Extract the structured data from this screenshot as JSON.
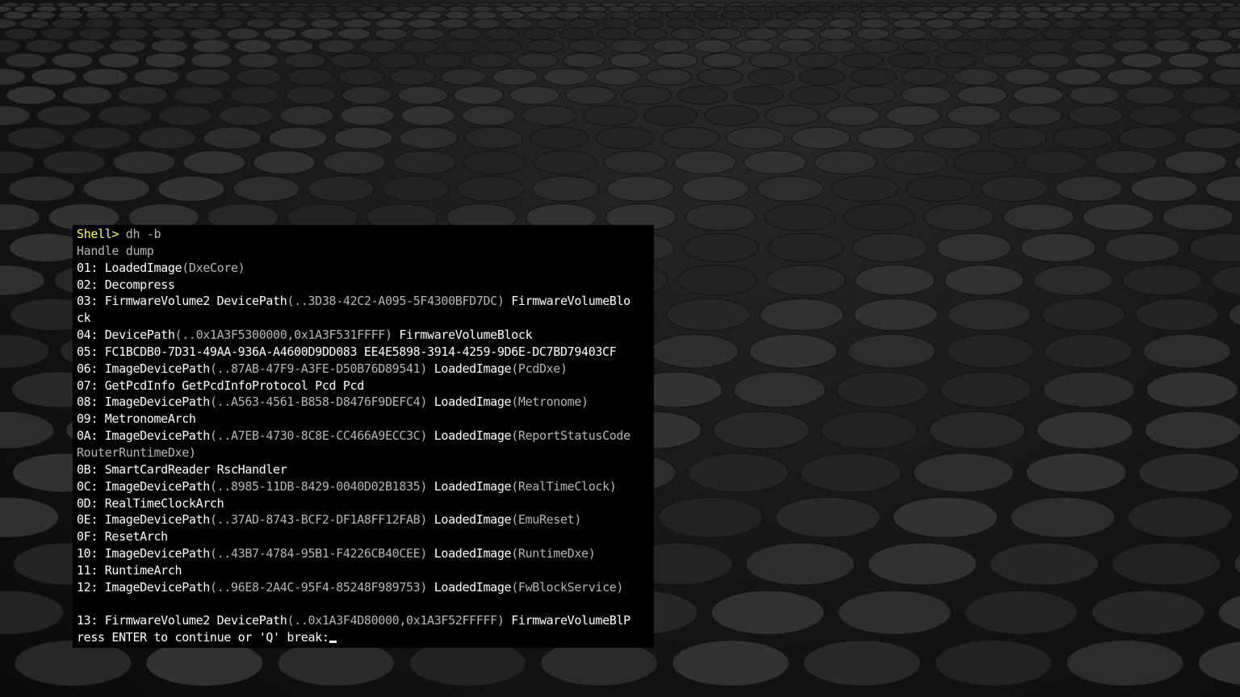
{
  "terminal": {
    "prompt": "Shell>",
    "command": " dh -b",
    "lines": [
      [
        {
          "t": "Handle dump",
          "c": "g"
        }
      ],
      [
        {
          "t": "01: LoadedImage",
          "c": "w"
        },
        {
          "t": "(DxeCore)",
          "c": "g"
        }
      ],
      [
        {
          "t": "02: Decompress",
          "c": "w"
        }
      ],
      [
        {
          "t": "03: FirmwareVolume2 DevicePath",
          "c": "w"
        },
        {
          "t": "(..3D38-42C2-A095-5F4300BFD7DC)",
          "c": "g"
        },
        {
          "t": " FirmwareVolumeBlo",
          "c": "w"
        }
      ],
      [
        {
          "t": "ck",
          "c": "w"
        }
      ],
      [
        {
          "t": "04: DevicePath",
          "c": "w"
        },
        {
          "t": "(..0x1A3F5300000,0x1A3F531FFFF)",
          "c": "g"
        },
        {
          "t": " FirmwareVolumeBlock",
          "c": "w"
        }
      ],
      [
        {
          "t": "05: FC1BCDB0-7D31-49AA-936A-A4600D9DD083 EE4E5898-3914-4259-9D6E-DC7BD79403CF",
          "c": "w"
        }
      ],
      [
        {
          "t": "06: ImageDevicePath",
          "c": "w"
        },
        {
          "t": "(..87AB-47F9-A3FE-D50B76D89541)",
          "c": "g"
        },
        {
          "t": " LoadedImage",
          "c": "w"
        },
        {
          "t": "(PcdDxe)",
          "c": "g"
        }
      ],
      [
        {
          "t": "07: GetPcdInfo GetPcdInfoProtocol Pcd Pcd",
          "c": "w"
        }
      ],
      [
        {
          "t": "08: ImageDevicePath",
          "c": "w"
        },
        {
          "t": "(..A563-4561-B858-D8476F9DEFC4)",
          "c": "g"
        },
        {
          "t": " LoadedImage",
          "c": "w"
        },
        {
          "t": "(Metronome)",
          "c": "g"
        }
      ],
      [
        {
          "t": "09: MetronomeArch",
          "c": "w"
        }
      ],
      [
        {
          "t": "0A: ImageDevicePath",
          "c": "w"
        },
        {
          "t": "(..A7EB-4730-8C8E-CC466A9ECC3C)",
          "c": "g"
        },
        {
          "t": " LoadedImage",
          "c": "w"
        },
        {
          "t": "(ReportStatusCode",
          "c": "g"
        }
      ],
      [
        {
          "t": "RouterRuntimeDxe)",
          "c": "g"
        }
      ],
      [
        {
          "t": "0B: SmartCardReader RscHandler",
          "c": "w"
        }
      ],
      [
        {
          "t": "0C: ImageDevicePath",
          "c": "w"
        },
        {
          "t": "(..8985-11DB-8429-0040D02B1835)",
          "c": "g"
        },
        {
          "t": " LoadedImage",
          "c": "w"
        },
        {
          "t": "(RealTimeClock)",
          "c": "g"
        }
      ],
      [
        {
          "t": "0D: RealTimeClockArch",
          "c": "w"
        }
      ],
      [
        {
          "t": "0E: ImageDevicePath",
          "c": "w"
        },
        {
          "t": "(..37AD-8743-BCF2-DF1A8FF12FAB)",
          "c": "g"
        },
        {
          "t": " LoadedImage",
          "c": "w"
        },
        {
          "t": "(EmuReset)",
          "c": "g"
        }
      ],
      [
        {
          "t": "0F: ResetArch",
          "c": "w"
        }
      ],
      [
        {
          "t": "10: ImageDevicePath",
          "c": "w"
        },
        {
          "t": "(..43B7-4784-95B1-F4226CB40CEE)",
          "c": "g"
        },
        {
          "t": " LoadedImage",
          "c": "w"
        },
        {
          "t": "(RuntimeDxe)",
          "c": "g"
        }
      ],
      [
        {
          "t": "11: RuntimeArch",
          "c": "w"
        }
      ],
      [
        {
          "t": "12: ImageDevicePath",
          "c": "w"
        },
        {
          "t": "(..96E8-2A4C-95F4-85248F989753)",
          "c": "g"
        },
        {
          "t": " LoadedImage",
          "c": "w"
        },
        {
          "t": "(FwBlockService)",
          "c": "g"
        }
      ],
      [],
      [
        {
          "t": "13: FirmwareVolume2 DevicePath",
          "c": "w"
        },
        {
          "t": "(..0x1A3F4D80000,0x1A3F52FFFFF)",
          "c": "g"
        },
        {
          "t": " FirmwareVolumeBlP",
          "c": "w"
        }
      ]
    ],
    "pause_prompt": "ress ENTER to continue or 'Q' break:"
  },
  "colors": {
    "prompt": "#ffff55",
    "bright_text": "#ffffff",
    "dim_text": "#b6b6b6",
    "terminal_background": "#000000"
  }
}
